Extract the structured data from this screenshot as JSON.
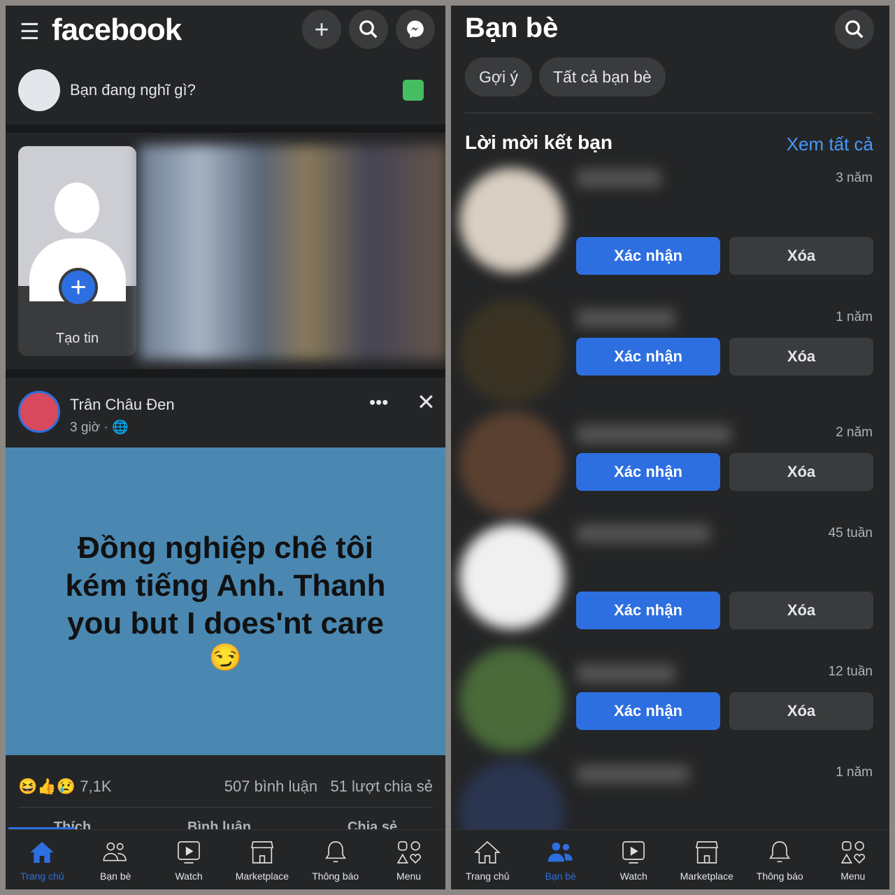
{
  "feed": {
    "logo": "facebook",
    "composer_placeholder": "Bạn đang nghĩ gì?",
    "create_story": "Tạo tin",
    "post": {
      "author": "Trân Châu Đen",
      "time": "3 giờ",
      "text": "Đồng nghiệp chê tôi kém tiếng Anh. Thanh you but I does'nt care",
      "emoji": "😏",
      "bg_color": "#4a88b2",
      "reactions": "7,1K",
      "comments": "507 bình luận",
      "shares": "51 lượt chia sẻ",
      "actions": [
        "Thích",
        "Bình luận",
        "Chia sẻ"
      ]
    }
  },
  "friends": {
    "title": "Bạn bè",
    "tabs": [
      "Gợi ý",
      "Tất cả bạn bè"
    ],
    "section": "Lời mời kết bạn",
    "see_all": "Xem tất cả",
    "requests": [
      {
        "time": "3 năm",
        "confirm": "Xác nhận",
        "delete": "Xóa"
      },
      {
        "time": "1 năm",
        "confirm": "Xác nhận",
        "delete": "Xóa"
      },
      {
        "time": "2 năm",
        "confirm": "Xác nhận",
        "delete": "Xóa"
      },
      {
        "time": "45 tuần",
        "confirm": "Xác nhận",
        "delete": "Xóa"
      },
      {
        "time": "12 tuần",
        "confirm": "Xác nhận",
        "delete": "Xóa"
      },
      {
        "time": "1 năm"
      }
    ]
  },
  "nav": [
    "Trang chủ",
    "Bạn bè",
    "Watch",
    "Marketplace",
    "Thông báo",
    "Menu"
  ],
  "colors": {
    "accent": "#2d6fe0",
    "bg": "#242526"
  }
}
